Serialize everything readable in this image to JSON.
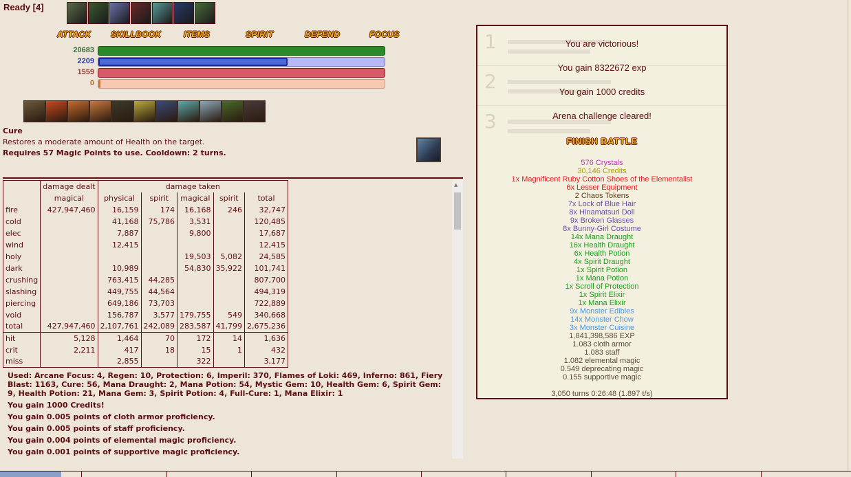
{
  "status": {
    "ready": "Ready [4]"
  },
  "effects": [
    {
      "icon": "effect-1-icon",
      "color": "#5a6a4a"
    },
    {
      "icon": "effect-2-icon",
      "color": "#3c5a30"
    },
    {
      "icon": "effect-3-icon",
      "color": "#6a70a8"
    },
    {
      "icon": "effect-4-icon",
      "color": "#6a2a2a"
    },
    {
      "icon": "effect-5-icon",
      "color": "#5a9a98"
    },
    {
      "icon": "effect-6-icon",
      "color": "#2a3a6a"
    },
    {
      "icon": "effect-7-icon",
      "color": "#4a6a3a"
    }
  ],
  "menu": [
    "ATTACK",
    "SKILLBOOK",
    "ITEMS",
    "SPIRIT",
    "DEFEND",
    "FOCUS"
  ],
  "vitals": [
    {
      "label": "20683",
      "fill": 1.0,
      "color": "#2a8a2a",
      "bg": "#2a8a2a",
      "border": "#1a5a1a",
      "text": "#3a6a3a"
    },
    {
      "label": "2209",
      "fill": 0.66,
      "color": "#4a6ad8",
      "bg": "#b8b8f8",
      "border": "#7a7ab0",
      "text": "#2a3ab8"
    },
    {
      "label": "1559",
      "fill": 1.0,
      "color": "#d85a6a",
      "bg": "#d85a6a",
      "border": "#8a1a2a",
      "text": "#9a3a3a"
    },
    {
      "label": "0",
      "fill": 0.0,
      "color": "#d8742a",
      "bg": "#f8c8b0",
      "border": "#c89a88",
      "text": "#b8642a"
    }
  ],
  "skills": [
    {
      "icon": "skill-1-icon",
      "color": "#6a5a3a"
    },
    {
      "icon": "skill-2-icon",
      "color": "#c84a1a"
    },
    {
      "icon": "skill-3-icon",
      "color": "#c86a2a"
    },
    {
      "icon": "skill-4-icon",
      "color": "#c8783a"
    },
    {
      "icon": "skill-5-icon",
      "color": "#3a3a2a"
    },
    {
      "icon": "skill-6-icon",
      "color": "#b8a83a"
    },
    {
      "icon": "skill-7-icon",
      "color": "#3a4a7a"
    },
    {
      "icon": "skill-8-icon",
      "color": "#5aa8a8"
    },
    {
      "icon": "skill-9-icon",
      "color": "#8aa8b8"
    },
    {
      "icon": "skill-10-icon",
      "color": "#4a6a2a"
    },
    {
      "icon": "skill-11-icon",
      "color": "#4a3a3a"
    }
  ],
  "skill_info": {
    "name": "Cure",
    "description": "Restores a moderate amount of Health on the target.",
    "requirement": "Requires 57 Magic Points to use. Cooldown: 2 turns."
  },
  "stats_table": {
    "group_headers": [
      "damage dealt",
      "damage taken"
    ],
    "sub_headers": [
      "magical",
      "physical",
      "spirit",
      "magical",
      "spirit",
      "total"
    ],
    "rows": [
      [
        "fire",
        "427,947,460",
        "16,159",
        "174",
        "16,168",
        "246",
        "32,747"
      ],
      [
        "cold",
        "",
        "41,168",
        "75,786",
        "3,531",
        "",
        "120,485"
      ],
      [
        "elec",
        "",
        "7,887",
        "",
        "9,800",
        "",
        "17,687"
      ],
      [
        "wind",
        "",
        "12,415",
        "",
        "",
        "",
        "12,415"
      ],
      [
        "holy",
        "",
        "",
        "",
        "19,503",
        "5,082",
        "24,585"
      ],
      [
        "dark",
        "",
        "10,989",
        "",
        "54,830",
        "35,922",
        "101,741"
      ],
      [
        "crushing",
        "",
        "763,415",
        "44,285",
        "",
        "",
        "807,700"
      ],
      [
        "slashing",
        "",
        "449,755",
        "44,564",
        "",
        "",
        "494,319"
      ],
      [
        "piercing",
        "",
        "649,186",
        "73,703",
        "",
        "",
        "722,889"
      ],
      [
        "void",
        "",
        "156,787",
        "3,577",
        "179,755",
        "549",
        "340,668"
      ],
      [
        "total",
        "427,947,460",
        "2,107,761",
        "242,089",
        "283,587",
        "41,799",
        "2,675,236"
      ]
    ],
    "hit_rows": [
      [
        "hit",
        "5,128",
        "1,464",
        "70",
        "172",
        "14",
        "1,636"
      ],
      [
        "crit",
        "2,211",
        "417",
        "18",
        "15",
        "1",
        "432"
      ],
      [
        "miss",
        "",
        "2,855",
        "",
        "322",
        "",
        "3,177"
      ]
    ]
  },
  "log": {
    "used": "Used: Arcane Focus: 4, Regen: 10, Protection: 6, Imperil: 370, Flames of Loki: 469, Inferno: 861, Fiery Blast: 1163, Cure: 56, Mana Draught: 2, Mana Potion: 54, Mystic Gem: 10, Health Gem: 6, Spirit Gem: 9, Health Potion: 21, Mana Gem: 3, Spirit Potion: 4, Full-Cure: 1, Mana Elixir: 1",
    "lines": [
      "You gain 1000 Credits!",
      "You gain 0.005 points of cloth armor proficiency.",
      "You gain 0.005 points of staff proficiency.",
      "You gain 0.004 points of elemental magic proficiency.",
      "You gain 0.001 points of supportive magic proficiency."
    ]
  },
  "result": {
    "messages": [
      "You are victorious!",
      "You gain 8322672 exp",
      "You gain 1000 credits",
      "Arena challenge cleared!"
    ],
    "finish_label": "FINISH BATTLE",
    "ghost_numbers": [
      "1",
      "2",
      "3"
    ],
    "loot": [
      {
        "text": "576 Crystals",
        "color": "#c030c0"
      },
      {
        "text": "30,146 Credits",
        "color": "#a8a010"
      },
      {
        "text": "1x Magnificent Ruby Cotton Shoes of the Elementalist",
        "color": "#e02020"
      },
      {
        "text": "6x Lesser Equipment",
        "color": "#e02020"
      },
      {
        "text": "2 Chaos Tokens",
        "color": "#5c3c1c"
      },
      {
        "text": "7x Lock of Blue Hair",
        "color": "#6a4ab0"
      },
      {
        "text": "8x Hinamatsuri Doll",
        "color": "#6a4ab0"
      },
      {
        "text": "9x Broken Glasses",
        "color": "#6a4ab0"
      },
      {
        "text": "8x Bunny-Girl Costume",
        "color": "#6a4ab0"
      },
      {
        "text": "14x Mana Draught",
        "color": "#1aa01a"
      },
      {
        "text": "16x Health Draught",
        "color": "#1aa01a"
      },
      {
        "text": "6x Health Potion",
        "color": "#1aa01a"
      },
      {
        "text": "4x Spirit Draught",
        "color": "#1aa01a"
      },
      {
        "text": "1x Spirit Potion",
        "color": "#1aa01a"
      },
      {
        "text": "1x Mana Potion",
        "color": "#1aa01a"
      },
      {
        "text": "1x Scroll of Protection",
        "color": "#1aa01a"
      },
      {
        "text": "1x Spirit Elixir",
        "color": "#1aa01a"
      },
      {
        "text": "1x Mana Elixir",
        "color": "#1aa01a"
      },
      {
        "text": "9x Monster Edibles",
        "color": "#4a98e0"
      },
      {
        "text": "14x Monster Chow",
        "color": "#4a98e0"
      },
      {
        "text": "3x Monster Cuisine",
        "color": "#4a98e0"
      },
      {
        "text": "1,841,398,586 EXP",
        "color": "#5c4c3c"
      },
      {
        "text": "1.083 cloth armor",
        "color": "#5c4c3c"
      },
      {
        "text": "1.083 staff",
        "color": "#5c4c3c"
      },
      {
        "text": "1.082 elemental magic",
        "color": "#5c4c3c"
      },
      {
        "text": "0.549 deprecating magic",
        "color": "#5c4c3c"
      },
      {
        "text": "0.155 supportive magic",
        "color": "#5c4c3c"
      }
    ],
    "turns": "3,050 turns 0:26:48 (1.897 t/s)"
  }
}
